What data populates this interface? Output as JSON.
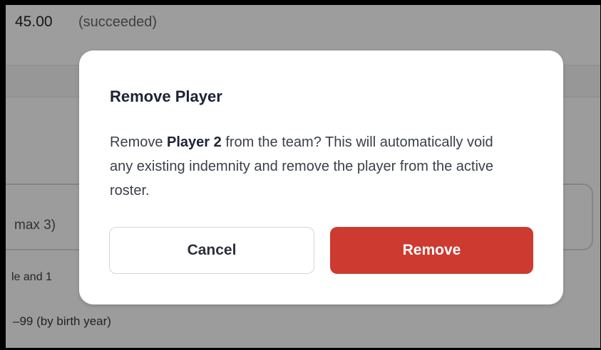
{
  "background": {
    "amount": "45.00",
    "status": "(succeeded)",
    "max_label": "max 3)",
    "age_text": "le and 1",
    "range_text": "–99 (by birth year)"
  },
  "dialog": {
    "title": "Remove Player",
    "body_prefix": "Remove ",
    "player_name": "Player 2",
    "body_suffix": " from the team? This will automatically void any existing indemnity and remove the player from the active roster.",
    "cancel_label": "Cancel",
    "remove_label": "Remove"
  },
  "colors": {
    "remove_button": "#cd3a2f",
    "overlay": "#9b9b9b"
  }
}
